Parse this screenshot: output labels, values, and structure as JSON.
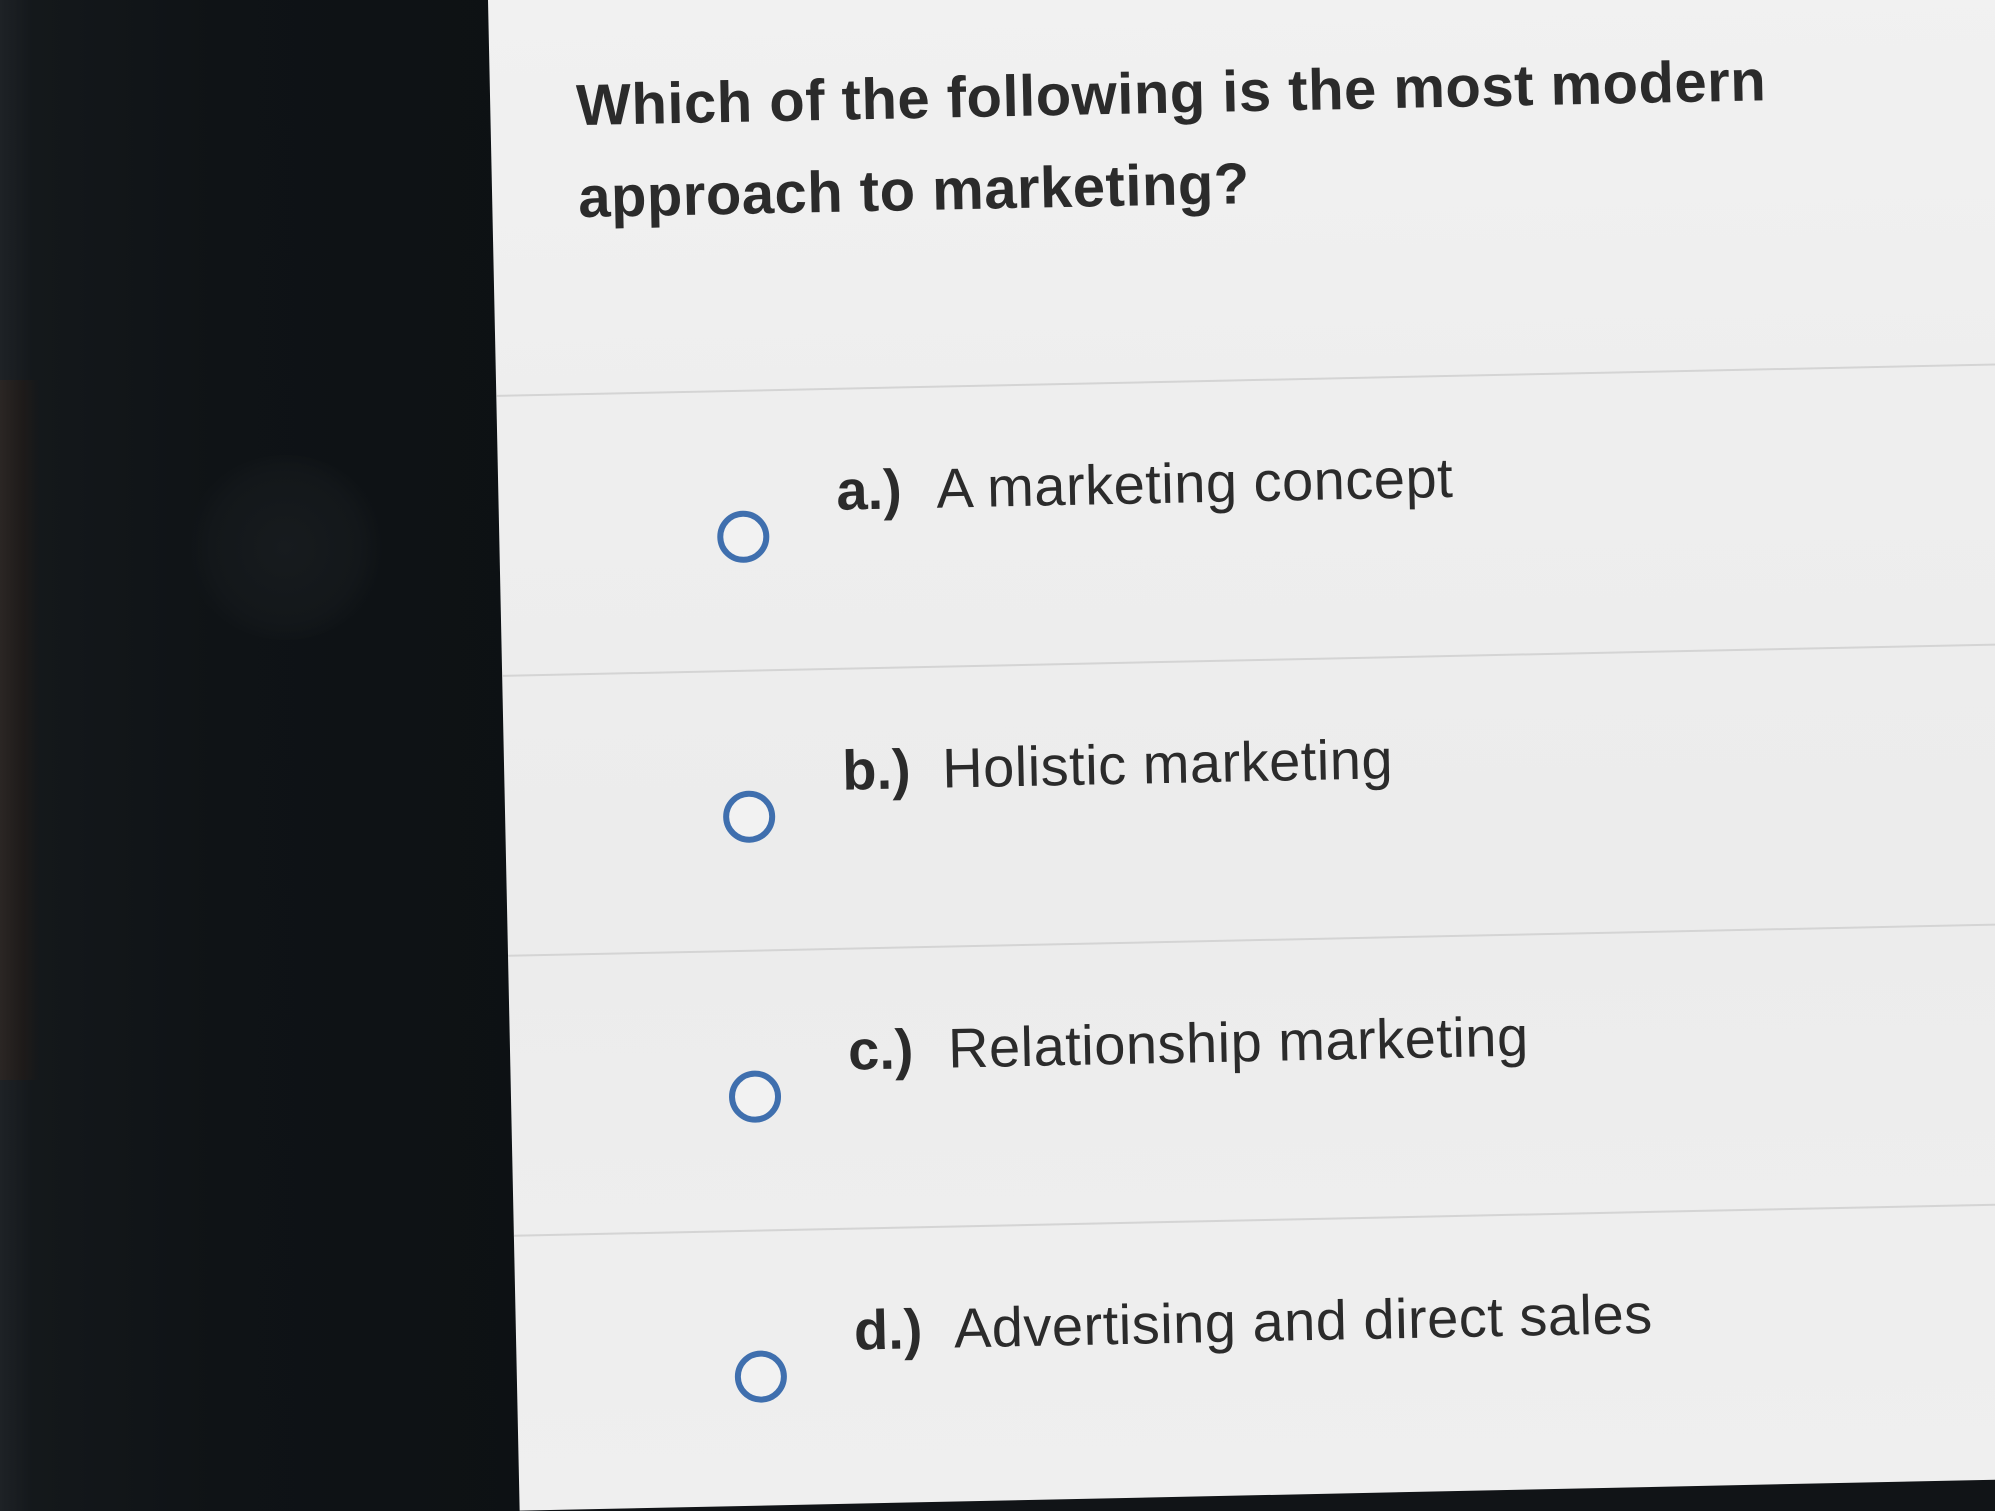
{
  "question": {
    "text": "Which of the following is the most modern approach to marketing?"
  },
  "options": [
    {
      "letter": "a.)",
      "text": "A marketing concept"
    },
    {
      "letter": "b.)",
      "text": "Holistic marketing"
    },
    {
      "letter": "c.)",
      "text": "Relationship marketing"
    },
    {
      "letter": "d.)",
      "text": "Advertising and direct sales"
    }
  ],
  "colors": {
    "radio_border": "#3f6fae",
    "text": "#2b2b2b",
    "divider": "#d4d4d4",
    "background": "#eeeeee"
  }
}
